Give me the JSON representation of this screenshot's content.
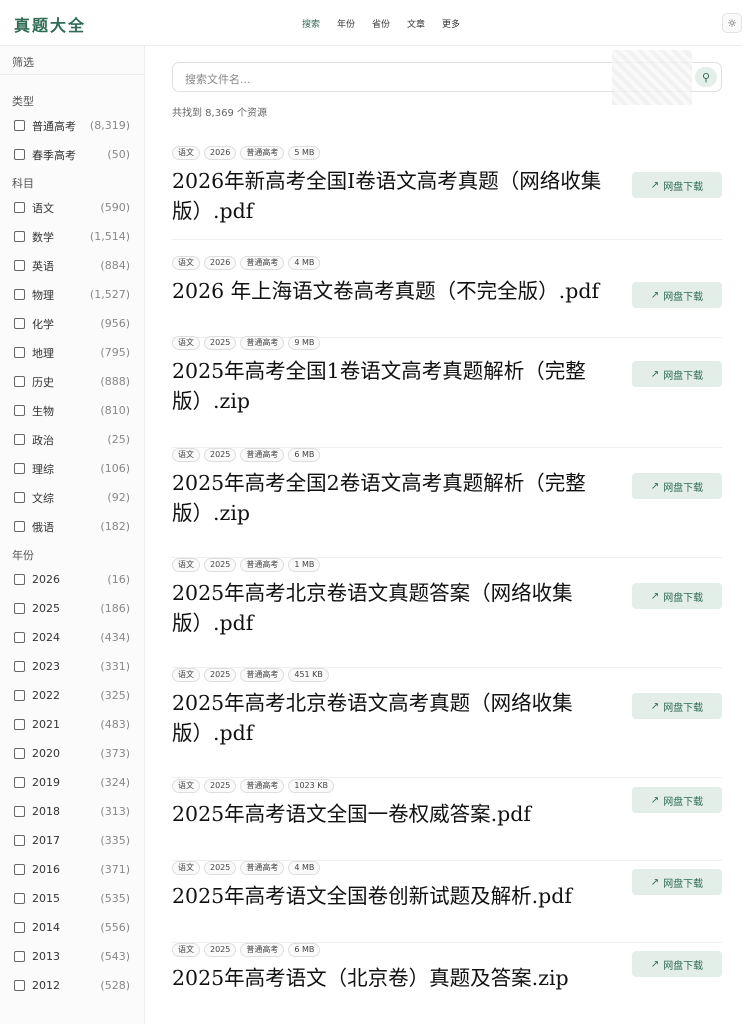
{
  "header": {
    "logo": "真题大全",
    "nav": [
      "搜索",
      "年份",
      "省份",
      "文章",
      "更多"
    ],
    "theme_icon": "☼"
  },
  "sidebar": {
    "filter_label": "筛选",
    "type_title": "类型",
    "types": [
      {
        "label": "普通高考",
        "count": "(8,319)"
      },
      {
        "label": "春季高考",
        "count": "(50)"
      }
    ],
    "subject_title": "科目",
    "subjects": [
      {
        "label": "语文",
        "count": "(590)"
      },
      {
        "label": "数学",
        "count": "(1,514)"
      },
      {
        "label": "英语",
        "count": "(884)"
      },
      {
        "label": "物理",
        "count": "(1,527)"
      },
      {
        "label": "化学",
        "count": "(956)"
      },
      {
        "label": "地理",
        "count": "(795)"
      },
      {
        "label": "历史",
        "count": "(888)"
      },
      {
        "label": "生物",
        "count": "(810)"
      },
      {
        "label": "政治",
        "count": "(25)"
      },
      {
        "label": "理综",
        "count": "(106)"
      },
      {
        "label": "文综",
        "count": "(92)"
      },
      {
        "label": "俄语",
        "count": "(182)"
      }
    ],
    "year_title": "年份",
    "years": [
      {
        "label": "2026",
        "count": "(16)"
      },
      {
        "label": "2025",
        "count": "(186)"
      },
      {
        "label": "2024",
        "count": "(434)"
      },
      {
        "label": "2023",
        "count": "(331)"
      },
      {
        "label": "2022",
        "count": "(325)"
      },
      {
        "label": "2021",
        "count": "(483)"
      },
      {
        "label": "2020",
        "count": "(373)"
      },
      {
        "label": "2019",
        "count": "(324)"
      },
      {
        "label": "2018",
        "count": "(313)"
      },
      {
        "label": "2017",
        "count": "(335)"
      },
      {
        "label": "2016",
        "count": "(371)"
      },
      {
        "label": "2015",
        "count": "(535)"
      },
      {
        "label": "2014",
        "count": "(556)"
      },
      {
        "label": "2013",
        "count": "(543)"
      },
      {
        "label": "2012",
        "count": "(528)"
      }
    ]
  },
  "search": {
    "placeholder": "搜索文件名...",
    "icon": "search-icon"
  },
  "results_summary": "共找到 8,369 个资源",
  "download_label": "网盘下载",
  "results": [
    {
      "tags": [
        "语文",
        "2026",
        "普通高考",
        "5 MB"
      ],
      "title": "2026年新高考全国I卷语文高考真题（网络收集版）.pdf"
    },
    {
      "tags": [
        "语文",
        "2026",
        "普通高考",
        "4 MB"
      ],
      "title": "2026 年上海语文卷高考真题（不完全版）.pdf"
    },
    {
      "tags": [
        "语文",
        "2025",
        "普通高考",
        "9 MB"
      ],
      "title": "2025年高考全国1卷语文高考真题解析（完整版）.zip"
    },
    {
      "tags": [
        "语文",
        "2025",
        "普通高考",
        "6 MB"
      ],
      "title": "2025年高考全国2卷语文高考真题解析（完整版）.zip"
    },
    {
      "tags": [
        "语文",
        "2025",
        "普通高考",
        "1 MB"
      ],
      "title": "2025年高考北京卷语文真题答案（网络收集版）.pdf"
    },
    {
      "tags": [
        "语文",
        "2025",
        "普通高考",
        "451 KB"
      ],
      "title": "2025年高考北京卷语文高考真题（网络收集版）.pdf"
    },
    {
      "tags": [
        "语文",
        "2025",
        "普通高考",
        "1023 KB"
      ],
      "title": "2025年高考语文全国一卷权威答案.pdf"
    },
    {
      "tags": [
        "语文",
        "2025",
        "普通高考",
        "4 MB"
      ],
      "title": "2025年高考语文全国卷创新试题及解析.pdf"
    },
    {
      "tags": [
        "语文",
        "2025",
        "普通高考",
        "6 MB"
      ],
      "title": "2025年高考语文（北京卷）真题及答案.zip"
    }
  ]
}
